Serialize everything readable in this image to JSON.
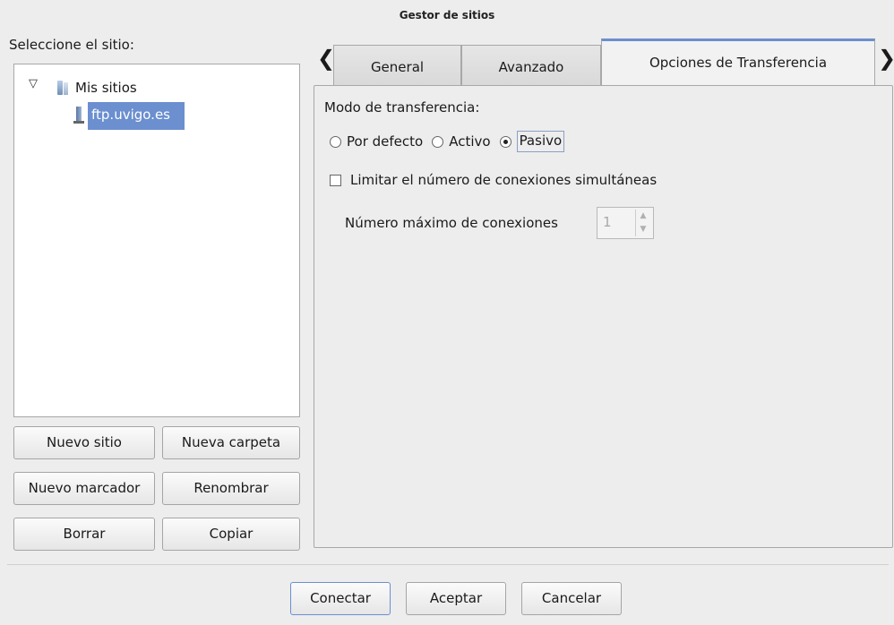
{
  "window": {
    "title": "Gestor de sitios"
  },
  "left": {
    "select_label": "Seleccione el sitio:",
    "tree": {
      "root_label": "Mis sitios",
      "site_label": "ftp.uvigo.es"
    },
    "buttons": {
      "new_site": "Nuevo sitio",
      "new_folder": "Nueva carpeta",
      "new_bookmark": "Nuevo marcador",
      "rename": "Renombrar",
      "delete": "Borrar",
      "copy": "Copiar"
    }
  },
  "tabs": [
    {
      "label": "General",
      "active": false
    },
    {
      "label": "Avanzado",
      "active": false
    },
    {
      "label": "Opciones de Transferencia",
      "active": true
    }
  ],
  "transfer": {
    "mode_label": "Modo de transferencia:",
    "options": [
      {
        "label": "Por defecto",
        "selected": false
      },
      {
        "label": "Activo",
        "selected": false
      },
      {
        "label": "Pasivo",
        "selected": true
      }
    ],
    "limit_label": "Limitar el número de conexiones simultáneas",
    "limit_checked": false,
    "max_label": "Número máximo de conexiones",
    "max_value": "1"
  },
  "footer": {
    "connect": "Conectar",
    "accept": "Aceptar",
    "cancel": "Cancelar"
  },
  "colors": {
    "accent": "#6b8fcf",
    "background": "#ededed"
  }
}
